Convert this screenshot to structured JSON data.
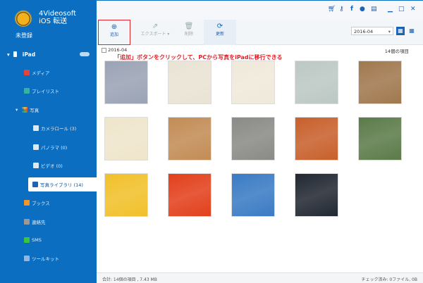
{
  "app": {
    "title_line1": "4Videosoft",
    "title_line2": "iOS 転送",
    "unregistered": "未登録"
  },
  "sidebar": {
    "device": "iPad",
    "items": [
      {
        "label": "メディア",
        "color": "#e8423a"
      },
      {
        "label": "プレイリスト",
        "color": "#35b39e"
      },
      {
        "label": "写真",
        "color": "#f4c039"
      },
      {
        "label": "カメラロール (3)",
        "color": "#dfe9f4"
      },
      {
        "label": "パノラマ (0)",
        "color": "#dfe9f4"
      },
      {
        "label": "ビデオ (0)",
        "color": "#dfe9f4"
      },
      {
        "label": "写真ライブラリ (14)",
        "color": "#1c63b4"
      },
      {
        "label": "ブックス",
        "color": "#f0962c"
      },
      {
        "label": "連絡先",
        "color": "#9a9a9a"
      },
      {
        "label": "SMS",
        "color": "#3cc43c"
      },
      {
        "label": "ツールキット",
        "color": "#8fb7e6"
      }
    ]
  },
  "toolbar": {
    "add": "追加",
    "export": "エクスポート",
    "delete": "削除",
    "refresh": "更新"
  },
  "date_filter": "2016-04",
  "group": {
    "date": "2016-04",
    "count": "14個の項目"
  },
  "hint": "「追加」ボタンをクリックして、PCから写真をiPadに移行できる",
  "photos": [
    "#9aa3b5",
    "#e9e3d4",
    "#efe9da",
    "#bcc8c4",
    "#a0784e",
    "#efe5cb",
    "#c28c55",
    "#8a8a86",
    "#c8602c",
    "#5b7b49",
    "#f1c02a",
    "#e2401c",
    "#3a7bc4",
    "#222832"
  ],
  "status": {
    "left": "合計:  14個の項目   ,  7.43 MB",
    "right": "チェック済み: 0ファイル, 0B"
  }
}
